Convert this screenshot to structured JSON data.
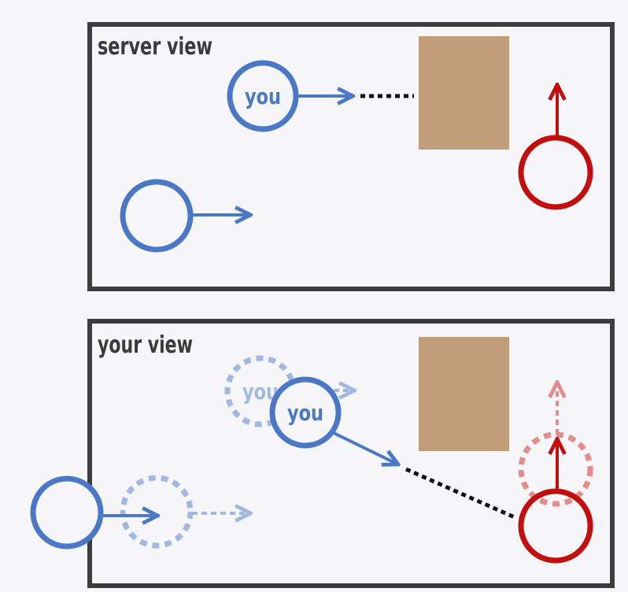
{
  "panels": {
    "server": {
      "label": "server view"
    },
    "yours": {
      "label": "your view"
    }
  },
  "player_label": "you",
  "colors": {
    "blue": "#4a78c7",
    "blue_faded": "#a3b8e0",
    "red": "#c30e0e",
    "red_faded": "#e38c8c",
    "obstacle": "#c29d79",
    "frame": "#3c3c3c",
    "background": "#f6f6f9"
  }
}
